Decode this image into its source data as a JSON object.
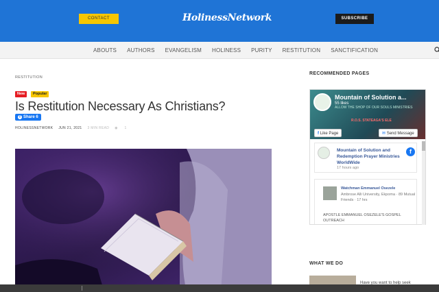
{
  "header": {
    "contact_label": "CONTACT",
    "logo_text": "HolinessNetwork",
    "subscribe_label": "SUBSCRIBE"
  },
  "nav": {
    "items": [
      "ABOUTS",
      "AUTHORS",
      "EVANGELISM",
      "HOLINESS",
      "PURITY",
      "RESTITUTION",
      "SANCTIFICATION"
    ],
    "search_icon": "search-icon"
  },
  "article": {
    "breadcrumb": "RESTITUTION",
    "badges": [
      "New",
      "Popular"
    ],
    "title": "Is Restitution Necessary As Christians?",
    "share_label": "Share 6",
    "author": "HOLINESSNETWORK",
    "date": "JUN 21, 2021",
    "read_time": "3 MIN READ",
    "views": "1"
  },
  "sidebar": {
    "recommended_heading": "RECOMMENDED PAGES",
    "fb_page": {
      "name": "Mountain of Solution a...",
      "likes": "55 likes",
      "tagline": "ALLOW THE SHOP OF OUR SOULS MINISTRIES",
      "cover_text": "R.O.S. STATEAGA'S ELE",
      "like_page_label": "Like Page",
      "send_message_label": "Send Message",
      "post_name": "Mountain of Solution and Redemption Prayer Ministries WorldWide",
      "post_time": "17 hours ago",
      "comment_name": "Watchman Emmanuel Osezele",
      "comment_sub": "Ambrose Alli University, Ekpoma · 89 Mutual Friends · 17 hrs",
      "comment_text": "APOSTLE EMMANUEL OSEZELE'S GOSPEL OUTREACH"
    },
    "what_we_do_heading": "WHAT WE DO",
    "what_we_do_text": "Have you want to help seek"
  },
  "colors": {
    "header_blue": "#1f74d6",
    "contact_yellow": "#f7c600",
    "facebook_blue": "#1877f2",
    "badge_red": "#e51c23"
  }
}
